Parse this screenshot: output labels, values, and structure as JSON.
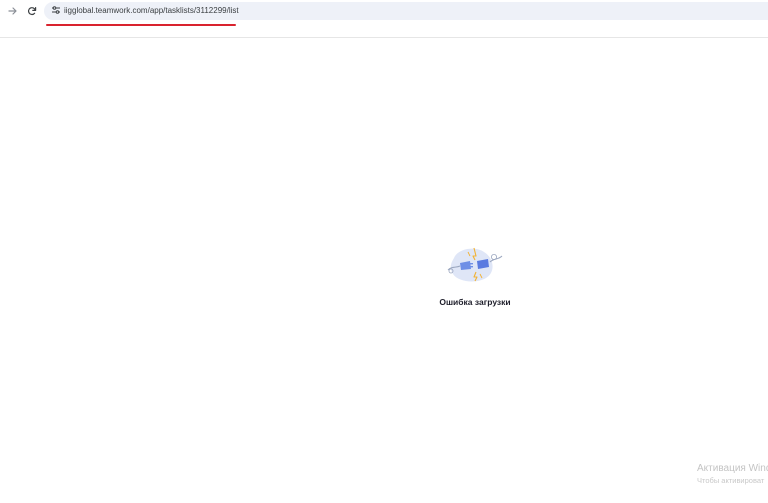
{
  "browser": {
    "url": "iigglobal.teamwork.com/app/tasklists/3112299/list",
    "icons": {
      "forward": "arrow-right-icon",
      "reload": "reload-icon",
      "site_settings": "tune-icon"
    },
    "accent_underline_color": "#d9232e"
  },
  "main": {
    "error_message": "Ошибка загрузки",
    "illustration": "unplugged-cable-icon"
  },
  "watermark": {
    "title": "Активация Wind",
    "subtitle": "Чтобы активироват"
  }
}
